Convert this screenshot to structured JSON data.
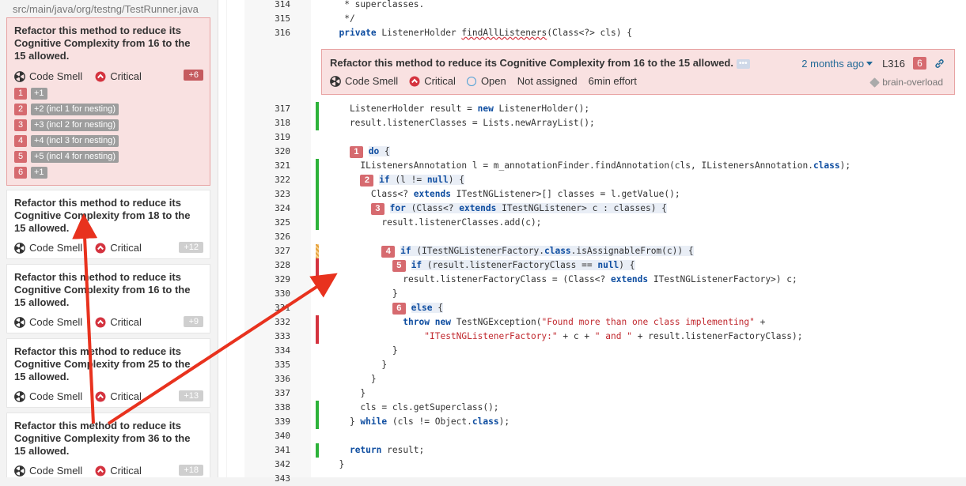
{
  "file_path": "src/main/java/org/testng/TestRunner.java",
  "issues": [
    {
      "title": "Refactor this method to reduce its Cognitive Complexity from 16 to the 15 allowed.",
      "type": "Code Smell",
      "severity": "Critical",
      "effort": "+6",
      "flows": [
        {
          "n": "1",
          "label": "+1"
        },
        {
          "n": "2",
          "label": "+2 (incl 1 for nesting)"
        },
        {
          "n": "3",
          "label": "+3 (incl 2 for nesting)"
        },
        {
          "n": "4",
          "label": "+4 (incl 3 for nesting)"
        },
        {
          "n": "5",
          "label": "+5 (incl 4 for nesting)"
        },
        {
          "n": "6",
          "label": "+1"
        }
      ]
    },
    {
      "title": "Refactor this method to reduce its Cognitive Complexity from 18 to the 15 allowed.",
      "type": "Code Smell",
      "severity": "Critical",
      "effort": "+12"
    },
    {
      "title": "Refactor this method to reduce its Cognitive Complexity from 16 to the 15 allowed.",
      "type": "Code Smell",
      "severity": "Critical",
      "effort": "+9"
    },
    {
      "title": "Refactor this method to reduce its Cognitive Complexity from 25 to the 15 allowed.",
      "type": "Code Smell",
      "severity": "Critical",
      "effort": "+13"
    },
    {
      "title": "Refactor this method to reduce its Cognitive Complexity from 36 to the 15 allowed.",
      "type": "Code Smell",
      "severity": "Critical",
      "effort": "+18"
    }
  ],
  "issue_box": {
    "title": "Refactor this method to reduce its Cognitive Complexity from 16 to the 15 allowed.",
    "dots": "•••",
    "age": "2 months ago",
    "line": "L316",
    "count": "6",
    "type": "Code Smell",
    "severity": "Critical",
    "status": "Open",
    "assignee": "Not assigned",
    "effort": "6min effort",
    "tag": "brain-overload"
  },
  "code": {
    "header_lines": [
      {
        "n": "314",
        "text": "   * superclasses."
      },
      {
        "n": "315",
        "text": "   */"
      },
      {
        "n": "316",
        "text": "  private ListenerHolder findAllListeners(Class<?> cls) {"
      }
    ],
    "lines": [
      {
        "n": "317",
        "text": "    ListenerHolder result = new ListenerHolder();"
      },
      {
        "n": "318",
        "text": "    result.listenerClasses = Lists.newArrayList();"
      },
      {
        "n": "319",
        "text": ""
      },
      {
        "n": "320",
        "text": "do {"
      },
      {
        "n": "321",
        "text": "      IListenersAnnotation l = m_annotationFinder.findAnnotation(cls, IListenersAnnotation.class);"
      },
      {
        "n": "322",
        "text": "if (l != null) {"
      },
      {
        "n": "323",
        "text": "        Class<? extends ITestNGListener>[] classes = l.getValue();"
      },
      {
        "n": "324",
        "text": "for (Class<? extends ITestNGListener> c : classes) {"
      },
      {
        "n": "325",
        "text": "          result.listenerClasses.add(c);"
      },
      {
        "n": "326",
        "text": ""
      },
      {
        "n": "327",
        "text": "if (ITestNGListenerFactory.class.isAssignableFrom(c)) {"
      },
      {
        "n": "328",
        "text": "if (result.listenerFactoryClass == null) {"
      },
      {
        "n": "329",
        "text": "              result.listenerFactoryClass = (Class<? extends ITestNGListenerFactory>) c;"
      },
      {
        "n": "330",
        "text": "            }"
      },
      {
        "n": "331",
        "text": "else {"
      },
      {
        "n": "332",
        "text": "              throw new TestNGException(\"Found more than one class implementing\" +"
      },
      {
        "n": "333",
        "text": "                  \"ITestNGListenerFactory:\" + c + \" and \" + result.listenerFactoryClass);"
      },
      {
        "n": "334",
        "text": "            }"
      },
      {
        "n": "335",
        "text": "          }"
      },
      {
        "n": "336",
        "text": "        }"
      },
      {
        "n": "337",
        "text": "      }"
      },
      {
        "n": "338",
        "text": "      cls = cls.getSuperclass();"
      },
      {
        "n": "339",
        "text": "    } while (cls != Object.class);"
      },
      {
        "n": "340",
        "text": ""
      },
      {
        "n": "341",
        "text": "    return result;"
      },
      {
        "n": "342",
        "text": "  }"
      },
      {
        "n": "343",
        "text": ""
      }
    ]
  },
  "colors": {
    "critical": "#d4333f",
    "accent": "#236a97",
    "selected_bg": "#f9e1e1",
    "arrow": "#e8321e"
  }
}
